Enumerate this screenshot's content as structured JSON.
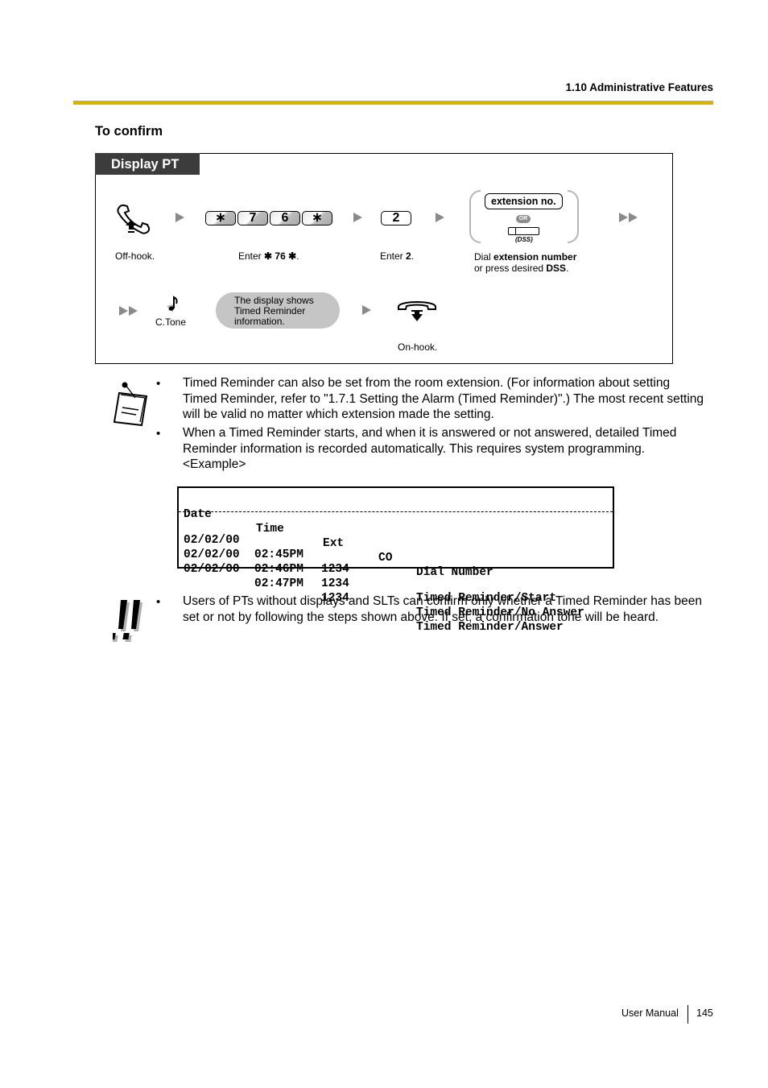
{
  "page": {
    "section_header": "1.10 Administrative Features",
    "subtitle": "To confirm",
    "accent_color": "#d9b300",
    "footer": {
      "label": "User Manual",
      "page_number": "145"
    }
  },
  "diagram": {
    "tab_label": "Display PT",
    "row1": {
      "step1": {
        "icon": "off-hook-handset-icon",
        "caption": "Off-hook."
      },
      "step2": {
        "keys": [
          "∗",
          "7",
          "6",
          "∗"
        ],
        "caption_prefix": "Enter ",
        "caption_bold": "✱ 76 ✱",
        "caption_suffix": "."
      },
      "step3": {
        "keys": [
          "2"
        ],
        "caption_prefix": "Enter ",
        "caption_bold": "2",
        "caption_suffix": "."
      },
      "step4": {
        "option1": "extension no.",
        "or_label": "OR",
        "option2_label": "(DSS)",
        "caption_line1_prefix": "Dial ",
        "caption_line1_bold": "extension number",
        "caption_line2_prefix": "or press desired ",
        "caption_line2_bold": "DSS",
        "caption_line2_suffix": "."
      }
    },
    "row2": {
      "tone_label": "C.Tone",
      "display_bubble": [
        "The display shows",
        "Timed Reminder",
        "information."
      ],
      "onhook_caption": "On-hook."
    }
  },
  "notes": {
    "bullets": [
      "Timed Reminder can also be set from the room extension. (For information about setting Timed Reminder, refer to \"1.7.1 Setting the Alarm (Timed Reminder)\".) The most recent setting will be valid no matter which extension made the setting.",
      "When a Timed Reminder starts, and when it is answered or not answered, detailed Timed Reminder information is recorded automatically. This requires system programming."
    ],
    "example_label": "<Example>"
  },
  "example_log": {
    "headers": [
      "Date",
      "Time",
      "Ext",
      "CO",
      "Dial Number"
    ],
    "rows": [
      [
        "02/02/00",
        "02:45PM",
        "1234",
        "",
        "Timed Reminder/Start"
      ],
      [
        "02/02/00",
        "02:46PM",
        "1234",
        "",
        "Timed Reminder/No Answer"
      ],
      [
        "02/02/00",
        "02:47PM",
        "1234",
        "",
        "Timed Reminder/Answer"
      ]
    ]
  },
  "warning": {
    "bullets": [
      "Users of PTs without displays and SLTs can confirm only whether a Timed Reminder has been set or not by following the steps shown above. If set, a confirmation tone will be heard."
    ]
  }
}
